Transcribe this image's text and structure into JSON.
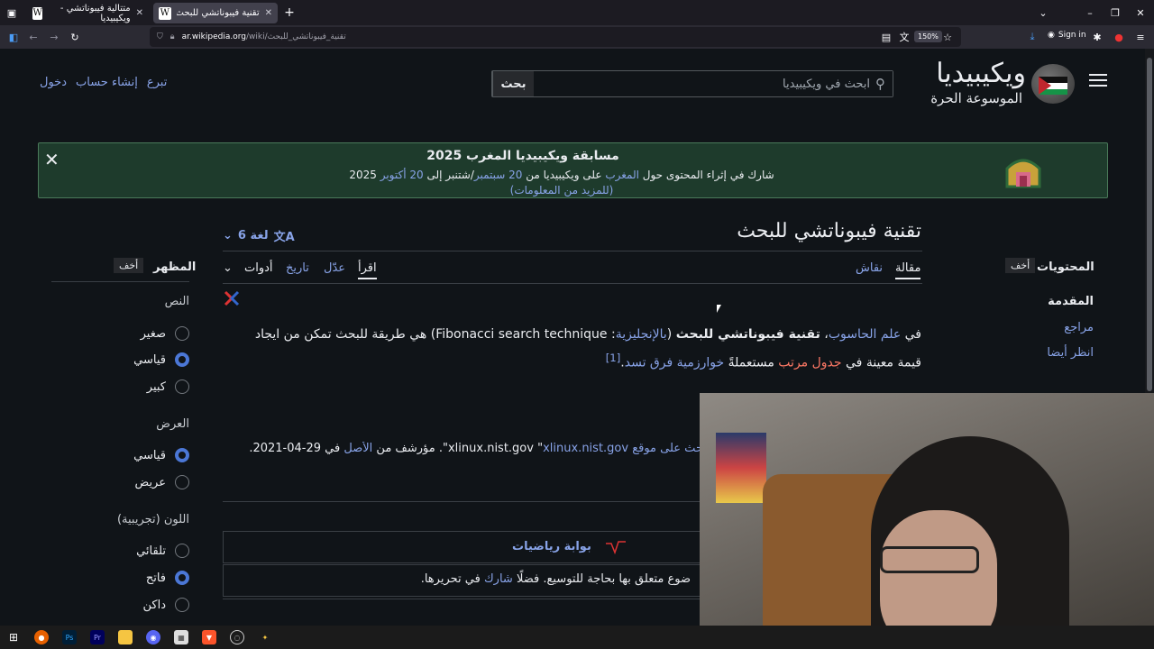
{
  "browser": {
    "tabs": [
      {
        "title": "متتالية فيبوناتشي - ويكيبيديا",
        "active": false
      },
      {
        "title": "تقنية فيبوناتشي للبحث - ويكيبيد",
        "active": true
      }
    ],
    "url_domain": "ar.wikipedia.org",
    "url_path": "/wiki/تقنية_فيبوناتشي_للبحث",
    "zoom": "150%",
    "sign_in": "Sign in"
  },
  "header": {
    "wordmark": "ويكيبيديا",
    "tagline": "الموسوعة الحرة",
    "search_placeholder": "ابحث في ويكيبيديا",
    "search_button": "بحث",
    "links": [
      "تبرع",
      "إنشاء حساب",
      "دخول"
    ]
  },
  "banner": {
    "title": "مسابقة ويكيبيديا المغرب 2025",
    "line_a": "شارك في إثراء المحتوى حول ",
    "line_link1": "المغرب",
    "line_b": " على ويكيبيديا من ",
    "line_link2": "20 سبتمبر",
    "line_c": "/شتنبر إلى ",
    "line_link3": "20 أكتوبر",
    "line_d": " 2025",
    "more": "(للمزيد من المعلومات)"
  },
  "article": {
    "title": "تقنية فيبوناتشي للبحث",
    "languages": "6 لغة",
    "tabs_right": [
      "مقالة",
      "نقاش"
    ],
    "tabs_left": [
      "اقرأ",
      "عدّل",
      "تاريخ",
      "أدوات"
    ],
    "p_in": "في ",
    "p_link_cs": "علم الحاسوب",
    "p_bold": "تقنية فيبوناتشي للبحث",
    "p_paren_open": " (",
    "p_link_en": "بالإنجليزية",
    "p_en": ": Fibonacci search technique",
    "p_rest": ") هي طريقة للبحث تمكن من ايجاد قيمة معينة في ",
    "p_redlink": "جدول مرتب",
    "p_using": " مستعملةً ",
    "p_link_alg": "خوارزمية فرق تسد",
    "p_end": ".",
    "p_ref": "[1]",
    "ref_a": "حث على موقع ",
    "ref_b": "xlinux.nist.gov",
    "ref_c": " \"",
    "ref_d": "xlinux.nist.gov",
    "ref_e": "\". مؤرشف من ",
    "ref_f": "الأصل",
    "ref_g": " في 29-04-2021.",
    "portal": "بوابة رياضيات",
    "stub_a": "ضوع متعلق بها بحاجة للتوسيع. فضلًا ",
    "stub_link": "شارك",
    "stub_b": " في تحريرها."
  },
  "toc": {
    "title": "المحتويات",
    "hide": "أخف",
    "items": [
      "المقدمة",
      "مراجع",
      "انظر أيضا"
    ]
  },
  "appearance": {
    "title": "المظهر",
    "hide": "أخف",
    "text_label": "النص",
    "text_opts": [
      "صغير",
      "قياسي",
      "كبير"
    ],
    "width_label": "العرض",
    "width_opts": [
      "قياسي",
      "عريض"
    ],
    "color_label": "اللون (تجريبية)",
    "color_opts": [
      "تلقائي",
      "فاتح",
      "داكن"
    ]
  },
  "colors": {
    "link": "#88a3e8",
    "redlink": "#fd7865",
    "banner_bg": "#1e3b2c",
    "radio_on": "#4b77d6"
  }
}
